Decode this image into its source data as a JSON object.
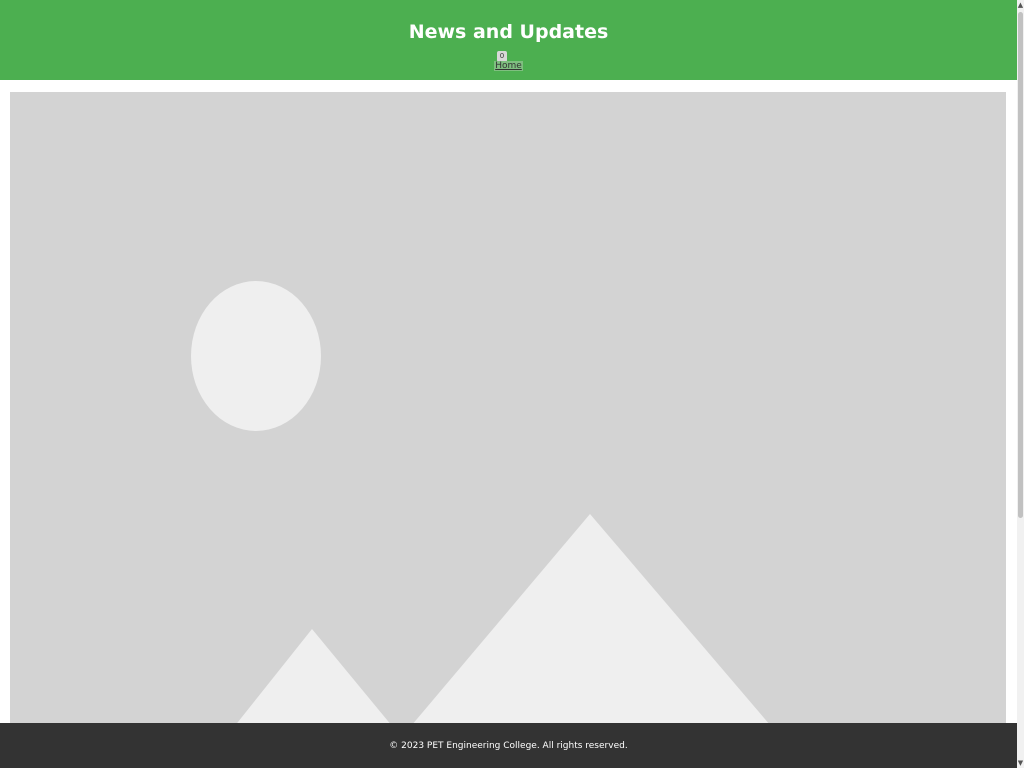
{
  "header": {
    "title": "News and Updates",
    "nav_badge": "0",
    "nav_link": "Home"
  },
  "main": {
    "image_placeholder": "image-placeholder-icon"
  },
  "footer": {
    "copyright": "© 2023 PET Engineering College. All rights reserved."
  },
  "colors": {
    "header_bg": "#4caf50",
    "footer_bg": "#333333",
    "placeholder_bg": "#d3d3d3",
    "placeholder_shape": "#efefef"
  }
}
